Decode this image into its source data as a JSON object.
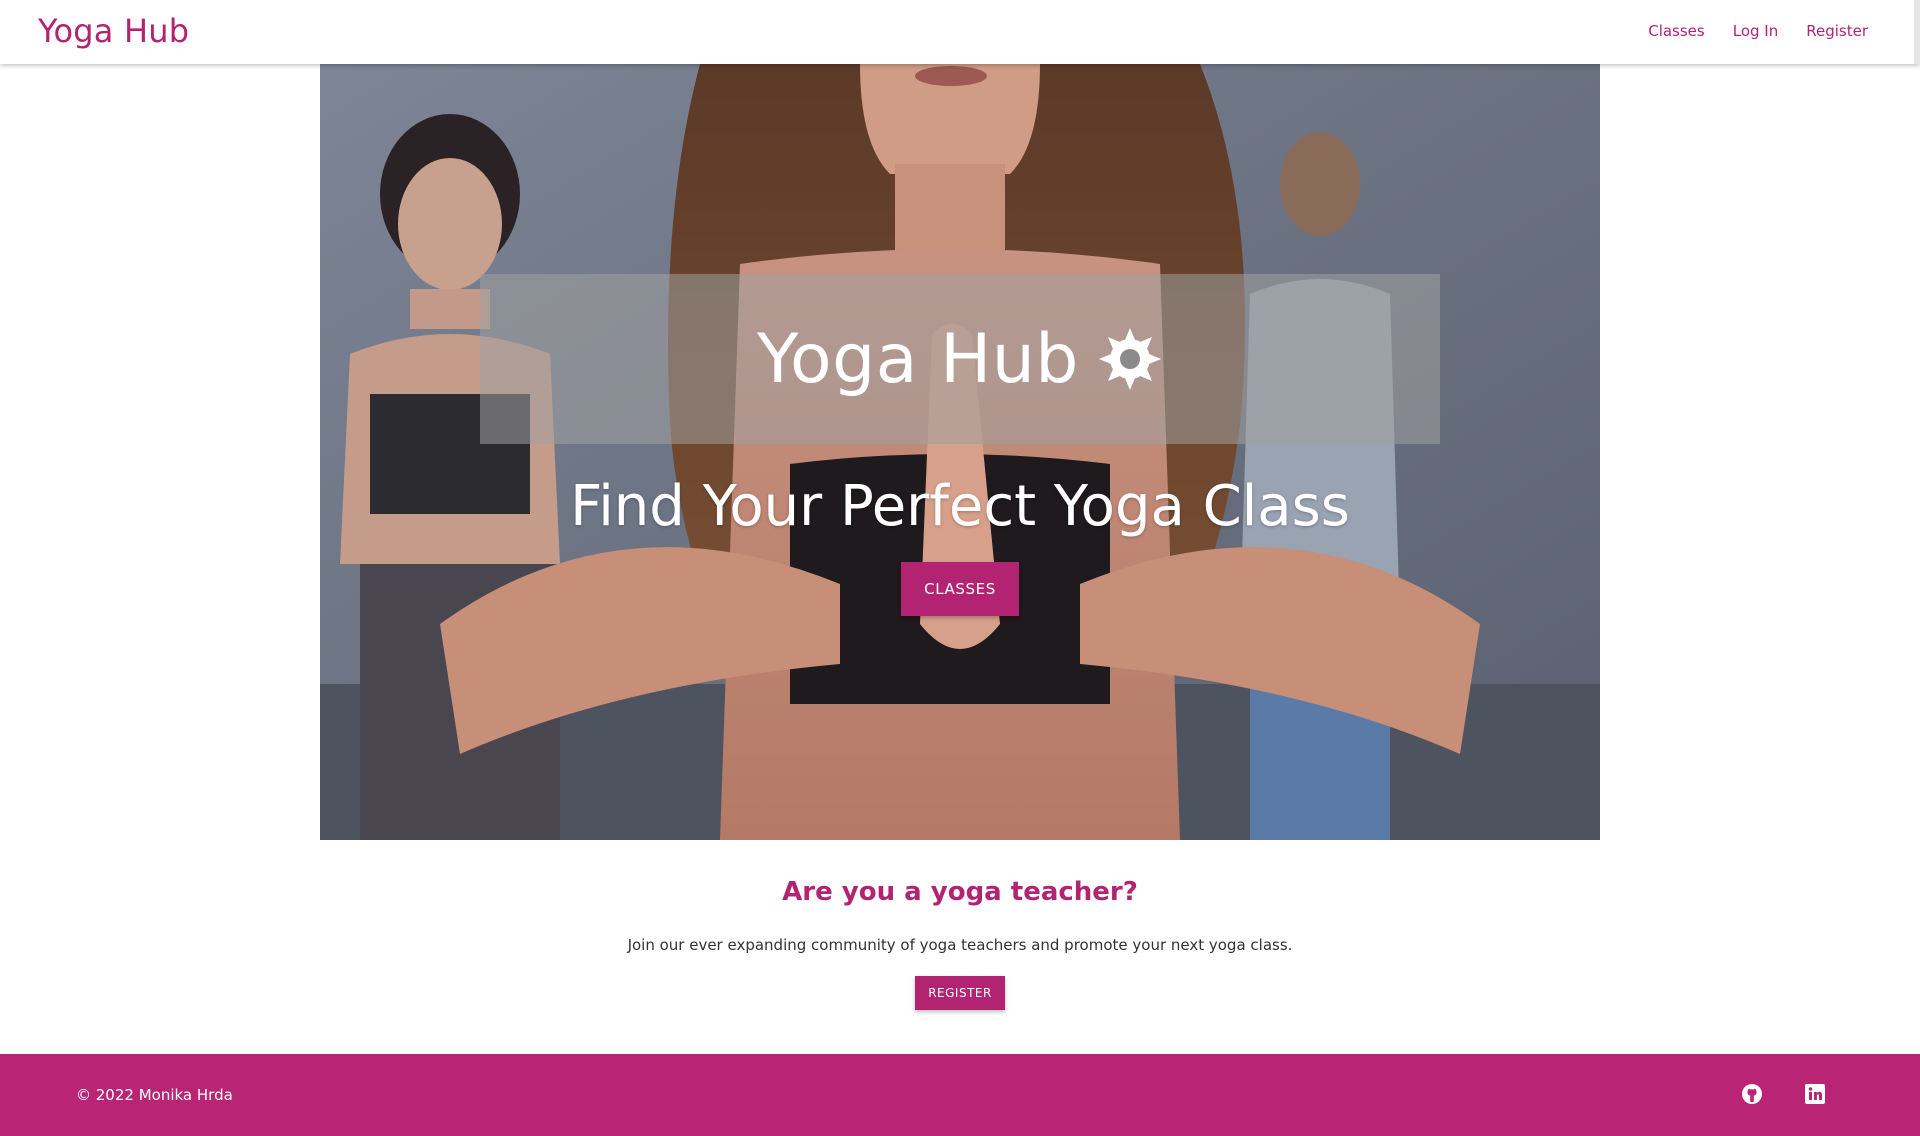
{
  "nav": {
    "brand": "Yoga Hub",
    "links": [
      "Classes",
      "Log In",
      "Register"
    ]
  },
  "hero": {
    "title": "Yoga Hub",
    "title_icon": "sun-icon",
    "subtitle": "Find Your Perfect Yoga Class",
    "button_label": "CLASSES"
  },
  "teacher": {
    "heading": "Are you a yoga teacher?",
    "text": "Join our ever expanding community of yoga teachers and promote your next yoga class.",
    "button_label": "REGISTER"
  },
  "footer": {
    "copyright": "© 2022 Monika Hrda",
    "icons": [
      "github-icon",
      "linkedin-icon"
    ]
  },
  "colors": {
    "accent": "#b22472",
    "footer_bg": "#b92574"
  }
}
